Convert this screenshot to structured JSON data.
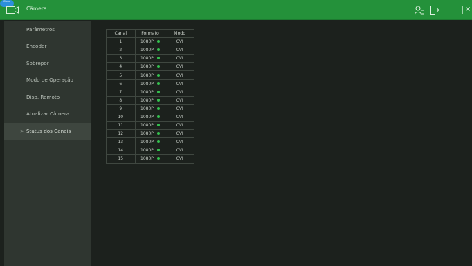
{
  "topbar": {
    "title": "Câmera",
    "icons": [
      "camera-icon",
      "user-icon",
      "logout-icon",
      "cloud-icon",
      "close-icon"
    ],
    "cloud_label": "Cloud",
    "close_glyph": "×",
    "accent_color": "#24913a"
  },
  "sidebar": {
    "items": [
      {
        "label": "Parâmetros"
      },
      {
        "label": "Encoder"
      },
      {
        "label": "Sobrepor"
      },
      {
        "label": "Modo de Operação"
      },
      {
        "label": "Disp. Remoto"
      },
      {
        "label": "Atualizar Câmera"
      },
      {
        "label": "Status dos Canais",
        "active": true,
        "indicator": ">"
      }
    ]
  },
  "table": {
    "headers": [
      "Canal",
      "Formato",
      "Modo"
    ],
    "status_color": "#35c04f",
    "rows": [
      {
        "canal": "1",
        "formato": "1080P",
        "modo": "CVI"
      },
      {
        "canal": "2",
        "formato": "1080P",
        "modo": "CVI"
      },
      {
        "canal": "3",
        "formato": "1080P",
        "modo": "CVI"
      },
      {
        "canal": "4",
        "formato": "1080P",
        "modo": "CVI"
      },
      {
        "canal": "5",
        "formato": "1080P",
        "modo": "CVI"
      },
      {
        "canal": "6",
        "formato": "1080P",
        "modo": "CVI"
      },
      {
        "canal": "7",
        "formato": "1080P",
        "modo": "CVI"
      },
      {
        "canal": "8",
        "formato": "1080P",
        "modo": "CVI"
      },
      {
        "canal": "9",
        "formato": "1080P",
        "modo": "CVI"
      },
      {
        "canal": "10",
        "formato": "1080P",
        "modo": "CVI"
      },
      {
        "canal": "11",
        "formato": "1080P",
        "modo": "CVI"
      },
      {
        "canal": "12",
        "formato": "1080P",
        "modo": "CVI"
      },
      {
        "canal": "13",
        "formato": "1080P",
        "modo": "CVI"
      },
      {
        "canal": "14",
        "formato": "1080P",
        "modo": "CVI"
      },
      {
        "canal": "15",
        "formato": "1080P",
        "modo": "CVI"
      }
    ]
  }
}
